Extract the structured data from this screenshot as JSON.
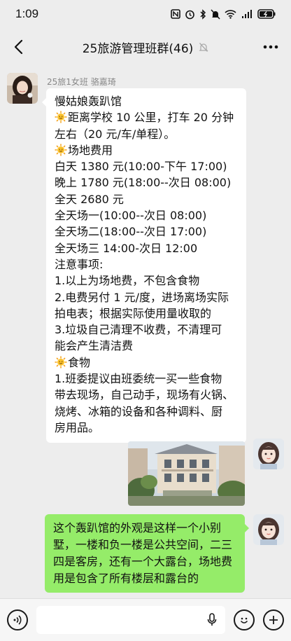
{
  "status_bar": {
    "time": "1:09",
    "icons": [
      "nfc-icon",
      "alarm-icon",
      "bluetooth-icon",
      "mute-icon",
      "wifi-icon",
      "signal-4g-icon",
      "battery-charging-icon"
    ],
    "signal_label": "4G"
  },
  "header": {
    "title": "25旅游管理班群(46)",
    "back_icon": "chevron-left-icon",
    "mute_icon": "bell-off-icon",
    "more_icon": "more-dots-icon"
  },
  "messages": {
    "first": {
      "sender": "25旅1女班 骆嘉琦",
      "lines": [
        "慢姑娘轰趴馆",
        "距离学校 10 公里，打车 20 分钟",
        "左右（20 元/车/单程）。",
        "场地费用",
        "白天 1380 元(10:00-下午 17:00)",
        "晚上 1780 元(18:00--次日 08:00)",
        "全天 2680 元",
        "全天场一(10:00--次日 08:00)",
        "全天场二(18:00--次日 17:00)",
        "全天场三 14:00-次日 12:00",
        "注意事项:",
        "1.以上为场地费，不包含食物",
        "2.电费另付 1 元/度，进场离场实际",
        "拍电表；根据实际使用量收取的",
        "3.垃圾自己清理不收费，不清理可",
        "能会产生清洁费",
        "食物",
        "1.班委提议由班委统一买一些食物",
        "带去现场，自己动手，现场有火锅、",
        "烧烤、冰箱的设备和各种调料、厨",
        "房用品。"
      ]
    },
    "reply": {
      "text": "这个轰趴馆的外观是这样一个小别墅，一楼和负一楼是公共空间，二三四是客房，还有一个大露台，场地费用是包含了所有楼层和露台的"
    }
  },
  "input_bar": {
    "voice_icon": "voice-icon",
    "mic_icon": "mic-icon",
    "emoji_icon": "emoji-icon",
    "plus_icon": "plus-icon",
    "placeholder": ""
  },
  "colors": {
    "background": "#ededed",
    "bubble_received": "#ffffff",
    "bubble_sent": "#95ec69",
    "accent_sun": "#f6a623"
  }
}
